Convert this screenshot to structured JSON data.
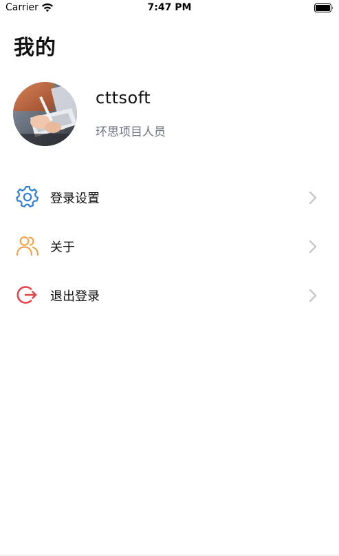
{
  "status_bar": {
    "carrier": "Carrier",
    "time": "7:47 PM"
  },
  "page": {
    "title": "我的"
  },
  "profile": {
    "username": "cttsoft",
    "role": "环思项目人员"
  },
  "menu": {
    "items": [
      {
        "label": "登录设置",
        "icon": "gear-icon",
        "color": "#2f7fd0"
      },
      {
        "label": "关于",
        "icon": "users-icon",
        "color": "#f0a24b"
      },
      {
        "label": "退出登录",
        "icon": "logout-icon",
        "color": "#e2434b"
      }
    ]
  },
  "colors": {
    "chevron": "#c7c7cc",
    "secondary_text": "#6f7380"
  }
}
